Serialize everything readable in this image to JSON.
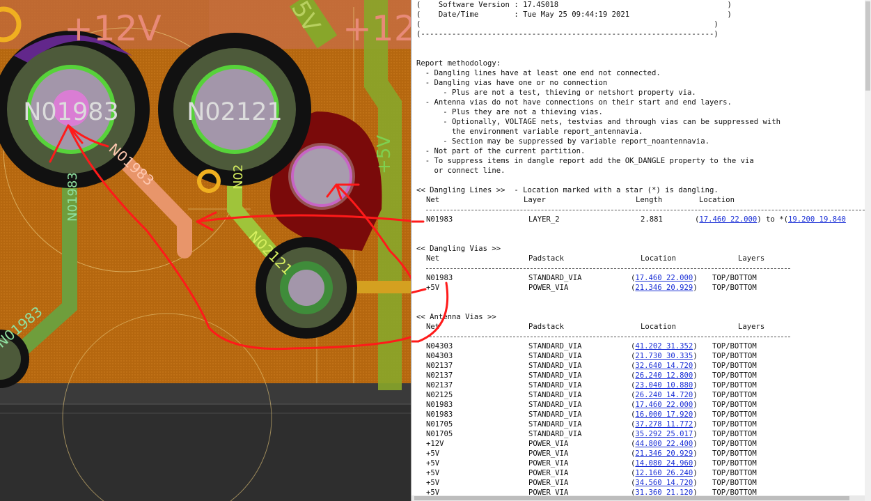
{
  "pcb": {
    "net_labels": {
      "n01983_via": "N01983",
      "n02121_via": "N02121",
      "plus12v_top": "+12V",
      "plus12v_right": "+12",
      "plus5v_top": "5V",
      "plus5v_side": "+5V",
      "n01983_trace": "N01983",
      "n01983_vertical": "N01983",
      "n02_vertical": "N02",
      "n02121_trace": "N02121",
      "n01983_bottom": "N01983"
    },
    "colors": {
      "board": "#b86a14",
      "dark_panel": "#2d2d2d",
      "via_ring": "#4d5a3a",
      "via_pad": "#9f92a8",
      "highlight_green": "#57d23a",
      "annotation_red": "#ff1a1a"
    }
  },
  "report": {
    "header": {
      "software_line": "(    Software Version : 17.4S018                                      )",
      "date_line": "(    Date/Time        : Tue May 25 09:44:19 2021                      )",
      "blank_line": "(                                                                  )",
      "border_line": "(------------------------------------------------------------------)"
    },
    "methodology": [
      "Report methodology:",
      "  - Dangling lines have at least one end not connected.",
      "  - Dangling vias have one or no connection",
      "      - Plus are not a test, thieving or netshort property via.",
      "  - Antenna vias do not have connections on their start and end layers.",
      "      - Plus they are not a thieving vias.",
      "      - Optionally, VOLTAGE nets, testvias and through vias can be suppressed with",
      "        the environment variable report_antennavia.",
      "      - Section may be suppressed by variable report_noantennavia.",
      "  - Not part of the current partition.",
      "  - To suppress items in dangle report add the OK_DANGLE property to the via",
      "    or connect line."
    ],
    "dangling_lines": {
      "heading": "<< Dangling Lines >>  - Location marked with a star (*) is dangling.",
      "headers": {
        "net": "Net",
        "layer": "Layer",
        "length": "Length",
        "location": "Location"
      },
      "row": {
        "net": "N01983",
        "layer": "LAYER_2",
        "length": "2.881",
        "open_paren": "(",
        "loc_start": "17.460 22.000",
        "mid": ") to *(",
        "loc_end": "19.200 19.840"
      }
    },
    "dangling_vias": {
      "heading": "<< Dangling Vias >>",
      "headers": {
        "net": "Net",
        "padstack": "Padstack",
        "location": "Location",
        "layers": "Layers"
      },
      "rows": [
        {
          "net": "N01983",
          "padstack": "STANDARD_VIA",
          "location": "17.460 22.000",
          "layers": "TOP/BOTTOM"
        },
        {
          "net": "+5V",
          "padstack": "POWER_VIA",
          "location": "21.346 20.929",
          "layers": "TOP/BOTTOM"
        }
      ]
    },
    "antenna_vias": {
      "heading": "<< Antenna Vias >>",
      "headers": {
        "net": "Net",
        "padstack": "Padstack",
        "location": "Location",
        "layers": "Layers"
      },
      "rows": [
        {
          "net": "N04303",
          "padstack": "STANDARD_VIA",
          "location": "41.202 31.352",
          "layers": "TOP/BOTTOM"
        },
        {
          "net": "N04303",
          "padstack": "STANDARD_VIA",
          "location": "21.730 30.335",
          "layers": "TOP/BOTTOM"
        },
        {
          "net": "N02137",
          "padstack": "STANDARD_VIA",
          "location": "32.640 14.720",
          "layers": "TOP/BOTTOM"
        },
        {
          "net": "N02137",
          "padstack": "STANDARD_VIA",
          "location": "26.240 12.800",
          "layers": "TOP/BOTTOM"
        },
        {
          "net": "N02137",
          "padstack": "STANDARD_VIA",
          "location": "23.040 10.880",
          "layers": "TOP/BOTTOM"
        },
        {
          "net": "N02125",
          "padstack": "STANDARD_VIA",
          "location": "26.240 14.720",
          "layers": "TOP/BOTTOM"
        },
        {
          "net": "N01983",
          "padstack": "STANDARD_VIA",
          "location": "17.460 22.000",
          "layers": "TOP/BOTTOM"
        },
        {
          "net": "N01983",
          "padstack": "STANDARD_VIA",
          "location": "16.000 17.920",
          "layers": "TOP/BOTTOM"
        },
        {
          "net": "N01705",
          "padstack": "STANDARD_VIA",
          "location": "37.278 11.772",
          "layers": "TOP/BOTTOM"
        },
        {
          "net": "N01705",
          "padstack": "STANDARD_VIA",
          "location": "35.292 25.017",
          "layers": "TOP/BOTTOM"
        },
        {
          "net": "+12V",
          "padstack": "POWER_VIA",
          "location": "44.800 22.400",
          "layers": "TOP/BOTTOM"
        },
        {
          "net": "+5V",
          "padstack": "POWER_VIA",
          "location": "21.346 20.929",
          "layers": "TOP/BOTTOM"
        },
        {
          "net": "+5V",
          "padstack": "POWER_VIA",
          "location": "14.080 24.960",
          "layers": "TOP/BOTTOM"
        },
        {
          "net": "+5V",
          "padstack": "POWER_VIA",
          "location": "12.160 26.240",
          "layers": "TOP/BOTTOM"
        },
        {
          "net": "+5V",
          "padstack": "POWER_VIA",
          "location": "34.560 14.720",
          "layers": "TOP/BOTTOM"
        },
        {
          "net": "+5V",
          "padstack": "POWER_VIA",
          "location": "31.360 21.120",
          "layers": "TOP/BOTTOM"
        }
      ]
    }
  }
}
